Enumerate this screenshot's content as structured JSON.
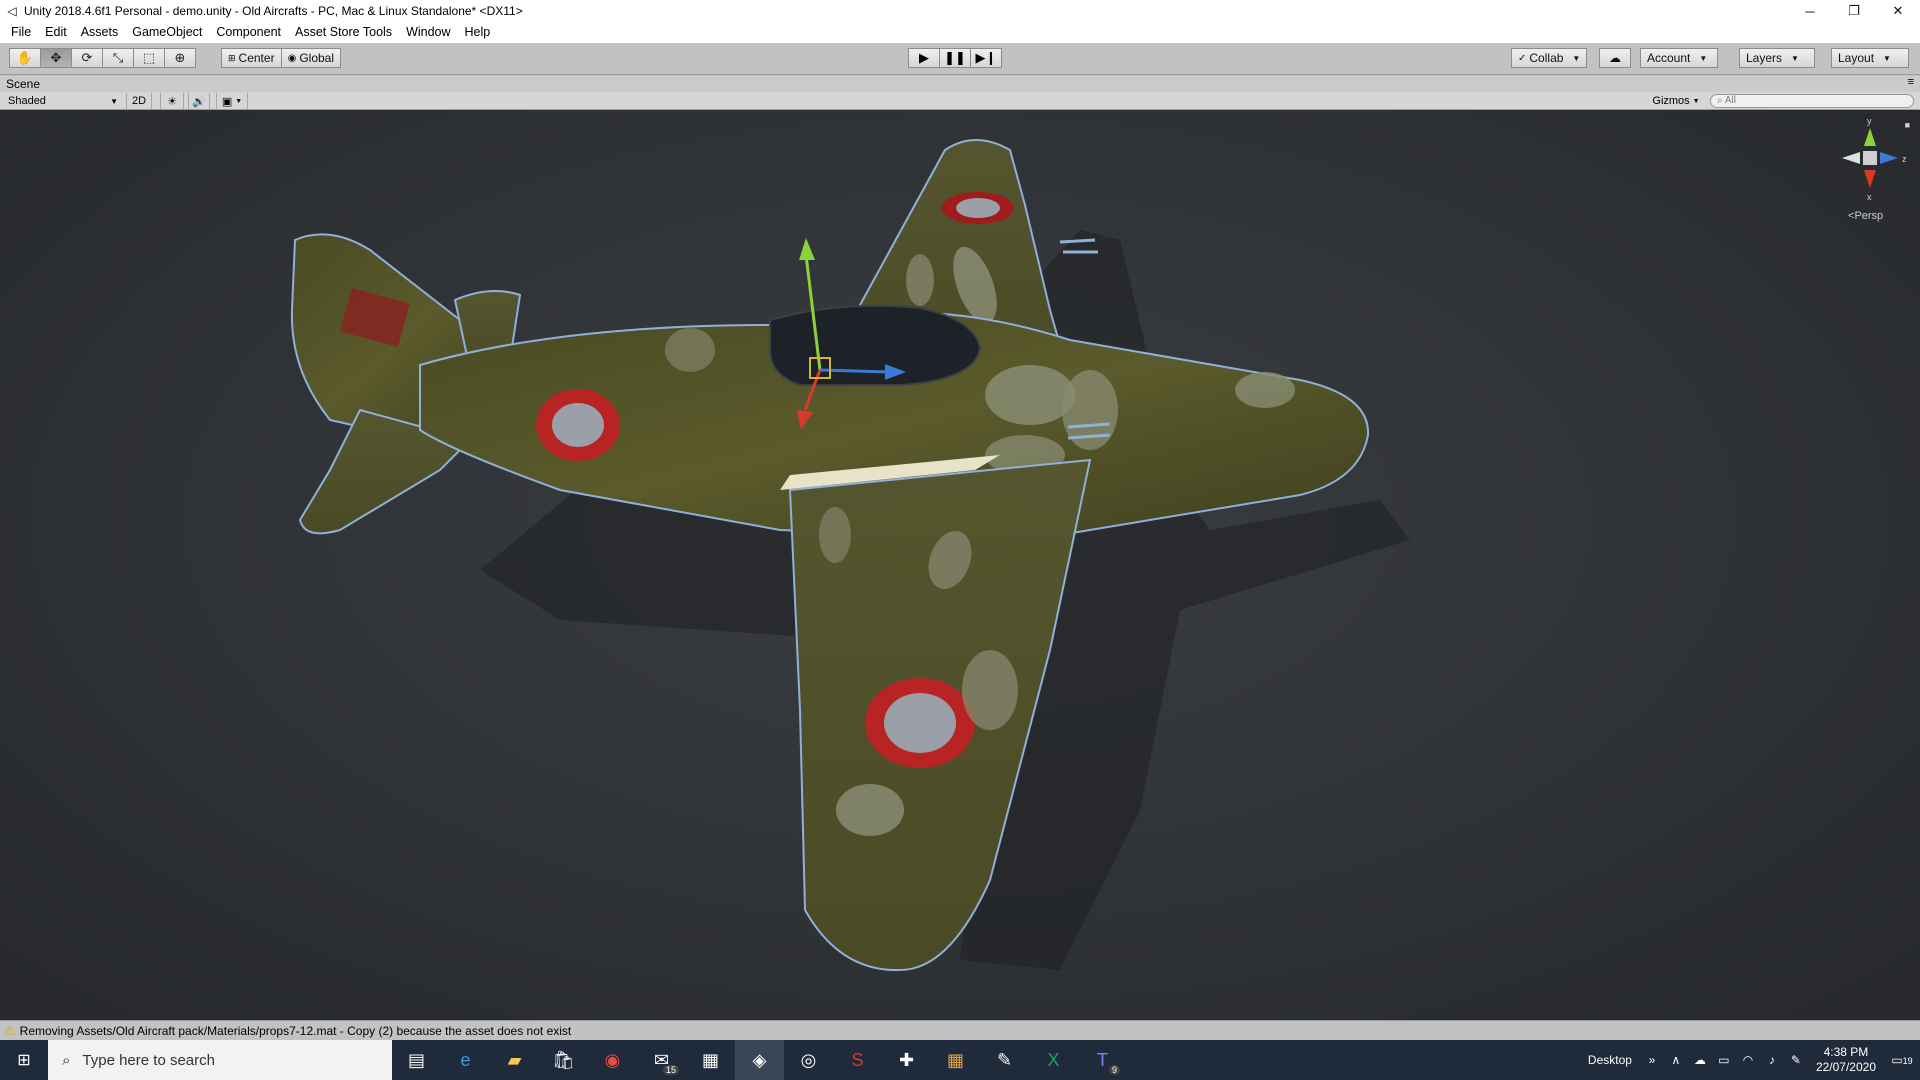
{
  "window": {
    "title": "Unity 2018.4.6f1 Personal - demo.unity - Old Aircrafts - PC, Mac & Linux Standalone* <DX11>",
    "minimize_glyph": "─",
    "restore_glyph": "❐",
    "close_glyph": "✕"
  },
  "menu": [
    "File",
    "Edit",
    "Assets",
    "GameObject",
    "Component",
    "Asset Store Tools",
    "Window",
    "Help"
  ],
  "toolbar": {
    "pivot_label": "Center",
    "space_label": "Global",
    "collab_label": "Collab",
    "account_label": "Account",
    "layers_label": "Layers",
    "layout_label": "Layout"
  },
  "scene": {
    "tab_label": "Scene",
    "shading_mode": "Shaded",
    "mode_2d_label": "2D",
    "gizmos_label": "Gizmos",
    "search_placeholder": "All",
    "gizmo_y": "y",
    "gizmo_z": "z",
    "gizmo_x": "x",
    "projection_label": "Persp"
  },
  "status": {
    "message": "Removing Assets/Old Aircraft pack/Materials/props7-12.mat - Copy (2) because the asset does not exist"
  },
  "taskbar": {
    "search_placeholder": "Type here to search",
    "desktop_label": "Desktop",
    "time": "4:38 PM",
    "date": "22/07/2020",
    "mail_badge": "15",
    "teams_badge": "9",
    "notifications_count": "19"
  },
  "colors": {
    "viewport_bg": "#2f3236",
    "plane_camo_dark": "#4a4a24",
    "plane_camo_light": "#8a8c73",
    "roundel_red": "#b82424",
    "selection_outline": "#8fb0d8"
  }
}
